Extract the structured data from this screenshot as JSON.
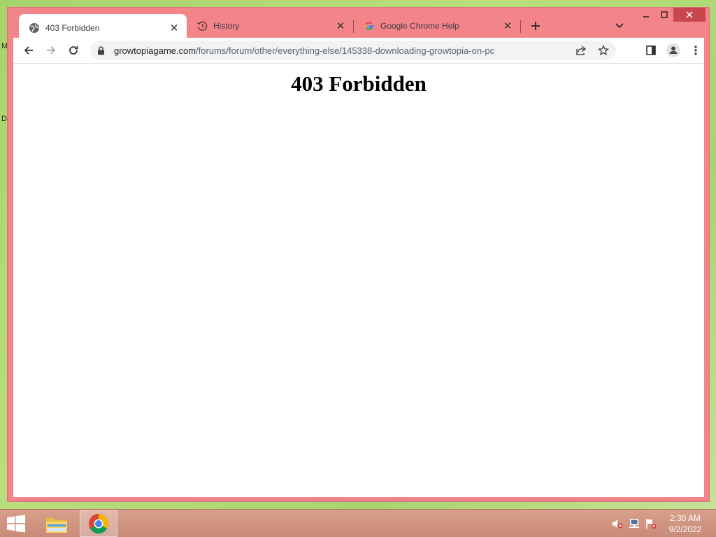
{
  "desktop": {
    "label_m": "M",
    "label_d": "D"
  },
  "tabs": [
    {
      "title": "403 Forbidden",
      "icon": "globe-icon",
      "active": true
    },
    {
      "title": "History",
      "icon": "history-icon",
      "active": false
    },
    {
      "title": "Google Chrome Help",
      "icon": "google-icon",
      "active": false
    }
  ],
  "omnibox": {
    "domain": "growtopiagame.com",
    "path": "/forums/forum/other/everything-else/145338-downloading-growtopia-on-pc"
  },
  "page": {
    "heading": "403 Forbidden"
  },
  "taskbar": {
    "time": "2:30 AM",
    "date": "9/2/2022",
    "apps": [
      "file-explorer-icon",
      "chrome-icon"
    ]
  },
  "colors": {
    "frame": "#f3858a",
    "close_button": "#c7484c",
    "taskbar": "#c98a7a",
    "desktop": "#a7d36c"
  }
}
